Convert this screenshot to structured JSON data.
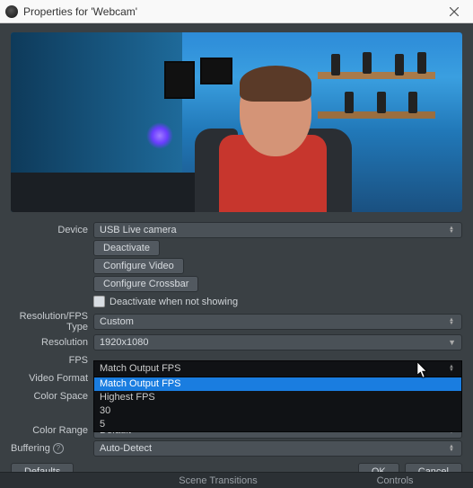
{
  "window": {
    "title": "Properties for 'Webcam'"
  },
  "form": {
    "device": {
      "label": "Device",
      "value": "USB  Live camera"
    },
    "buttons": {
      "deactivate": "Deactivate",
      "configure_video": "Configure Video",
      "configure_crossbar": "Configure Crossbar"
    },
    "checkbox": {
      "deactivate_not_showing": "Deactivate when not showing"
    },
    "resfps_type": {
      "label": "Resolution/FPS Type",
      "value": "Custom"
    },
    "resolution": {
      "label": "Resolution",
      "value": "1920x1080"
    },
    "fps": {
      "label": "FPS",
      "value": "Match Output FPS",
      "options": [
        "Match Output FPS",
        "Highest FPS",
        "30",
        "5"
      ]
    },
    "video_format": {
      "label": "Video Format"
    },
    "color_space": {
      "label": "Color Space"
    },
    "color_range": {
      "label": "Color Range",
      "value": "Default"
    },
    "buffering": {
      "label": "Buffering",
      "value": "Auto-Detect"
    }
  },
  "bottom": {
    "defaults": "Defaults",
    "ok": "OK",
    "cancel": "Cancel"
  },
  "status": {
    "center": "Scene Transitions",
    "right": "Controls"
  }
}
